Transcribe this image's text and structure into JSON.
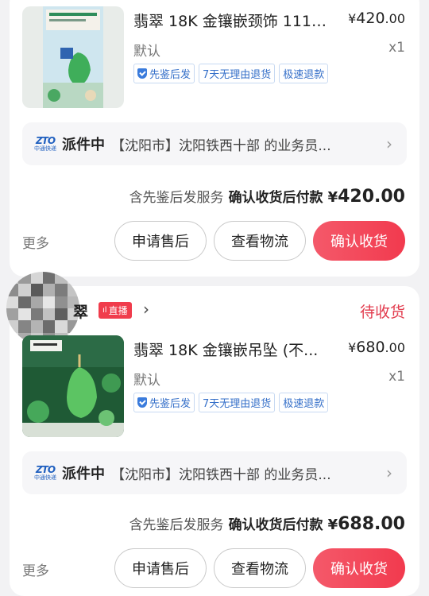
{
  "orders": [
    {
      "product": {
        "title": "翡翠 18K 金镶嵌颈饰 1111...",
        "price_cur": "¥",
        "price_int": "420",
        "price_dec": ".00",
        "sku": "默认",
        "qty": "x1",
        "tags": [
          "先鉴后发",
          "7天无理由退货",
          "极速退款"
        ]
      },
      "logistics": {
        "carrier_logo": "ZTO",
        "carrier_sub": "中通快递",
        "status": "派件中",
        "detail": "【沈阳市】沈阳铁西十部 的业务员..."
      },
      "payment": {
        "service": "含先鉴后发服务",
        "condition": "确认收货后付款",
        "cur": "¥",
        "amount": "420.00"
      },
      "actions": {
        "more": "更多",
        "after_sales": "申请售后",
        "track": "查看物流",
        "confirm": "确认收货"
      }
    },
    {
      "shop": {
        "name": "翠",
        "live_badge": "直播",
        "status": "待收货"
      },
      "product": {
        "title": "翡翠 18K 金镶嵌吊坠 (不...",
        "price_cur": "¥",
        "price_int": "680",
        "price_dec": ".00",
        "sku": "默认",
        "qty": "x1",
        "tags": [
          "先鉴后发",
          "7天无理由退货",
          "极速退款"
        ]
      },
      "logistics": {
        "carrier_logo": "ZTO",
        "carrier_sub": "中通快递",
        "status": "派件中",
        "detail": "【沈阳市】沈阳铁西十部 的业务员..."
      },
      "payment": {
        "service": "含先鉴后发服务",
        "condition": "确认收货后付款",
        "cur": "¥",
        "amount": "688.00"
      },
      "actions": {
        "more": "更多",
        "after_sales": "申请售后",
        "track": "查看物流",
        "confirm": "确认收货"
      }
    }
  ],
  "colors": {
    "accent_red": "#f23a4e",
    "status_red": "#e23c4e",
    "tag_blue": "#3670c9"
  }
}
